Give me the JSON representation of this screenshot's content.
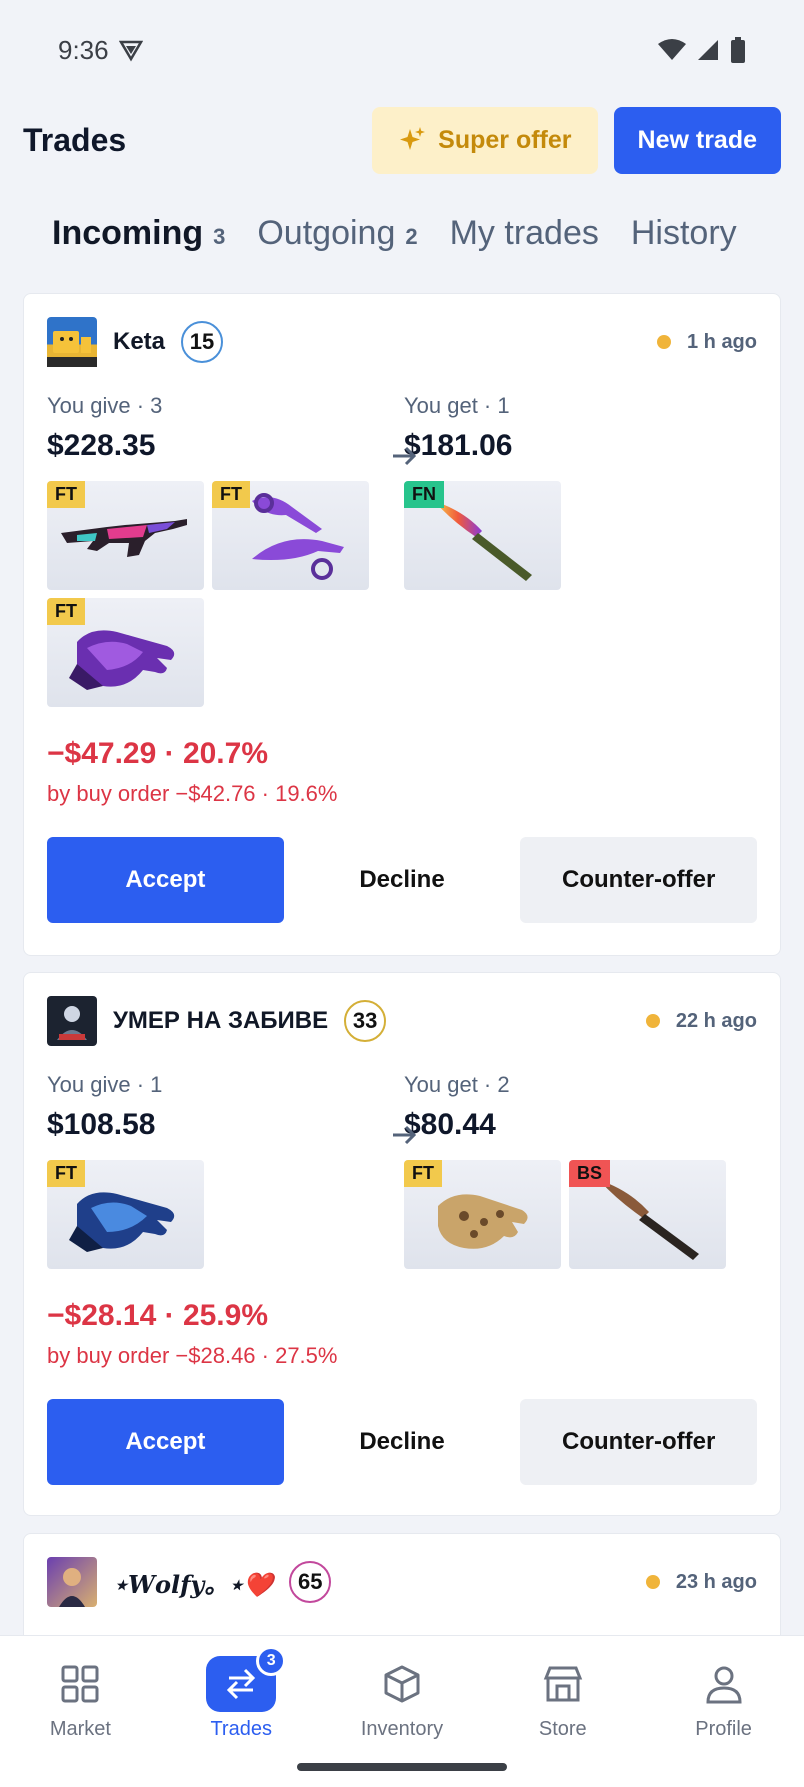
{
  "status": {
    "time": "9:36"
  },
  "header": {
    "title": "Trades",
    "super_offer": "Super offer",
    "new_trade": "New trade"
  },
  "tabs": [
    {
      "label": "Incoming",
      "count": "3"
    },
    {
      "label": "Outgoing",
      "count": "2"
    },
    {
      "label": "My trades",
      "count": ""
    },
    {
      "label": "History",
      "count": ""
    }
  ],
  "trades": [
    {
      "user": "Keta",
      "level": "15",
      "level_color": "#4a90d9",
      "ago": "1 h ago",
      "give_label": "You give · 3",
      "give_sum": "$228.35",
      "get_label": "You get · 1",
      "get_sum": "$181.06",
      "give_items": [
        {
          "wear": "FT",
          "icon": "rifle-icon"
        },
        {
          "wear": "FT",
          "icon": "daggers-icon"
        },
        {
          "wear": "FT",
          "icon": "gloves-icon"
        }
      ],
      "get_items": [
        {
          "wear": "FN",
          "icon": "knife-icon"
        }
      ],
      "loss": "−$47.29 · 20.7%",
      "loss_buy": "by buy order −$42.76 · 19.6%",
      "accept": "Accept",
      "decline": "Decline",
      "counter": "Counter-offer"
    },
    {
      "user": "УМЕР НА ЗАБИВЕ",
      "level": "33",
      "level_color": "#d4af37",
      "ago": "22 h ago",
      "give_label": "You give · 1",
      "give_sum": "$108.58",
      "get_label": "You get · 2",
      "get_sum": "$80.44",
      "give_items": [
        {
          "wear": "FT",
          "icon": "gloves-icon"
        }
      ],
      "get_items": [
        {
          "wear": "FT",
          "icon": "gloves-icon"
        },
        {
          "wear": "BS",
          "icon": "knife-icon"
        }
      ],
      "loss": "−$28.14 · 25.9%",
      "loss_buy": "by buy order −$28.46 · 27.5%",
      "accept": "Accept",
      "decline": "Decline",
      "counter": "Counter-offer"
    },
    {
      "user": "⋆𝑾𝒐𝒍𝒇𝒚。⋆❤️",
      "level": "65",
      "level_color": "#c2489c",
      "ago": "23 h ago"
    }
  ],
  "nav": [
    {
      "label": "Market",
      "icon": "grid-icon"
    },
    {
      "label": "Trades",
      "icon": "swap-icon",
      "badge": "3"
    },
    {
      "label": "Inventory",
      "icon": "box-icon"
    },
    {
      "label": "Store",
      "icon": "store-icon"
    },
    {
      "label": "Profile",
      "icon": "person-icon"
    }
  ]
}
